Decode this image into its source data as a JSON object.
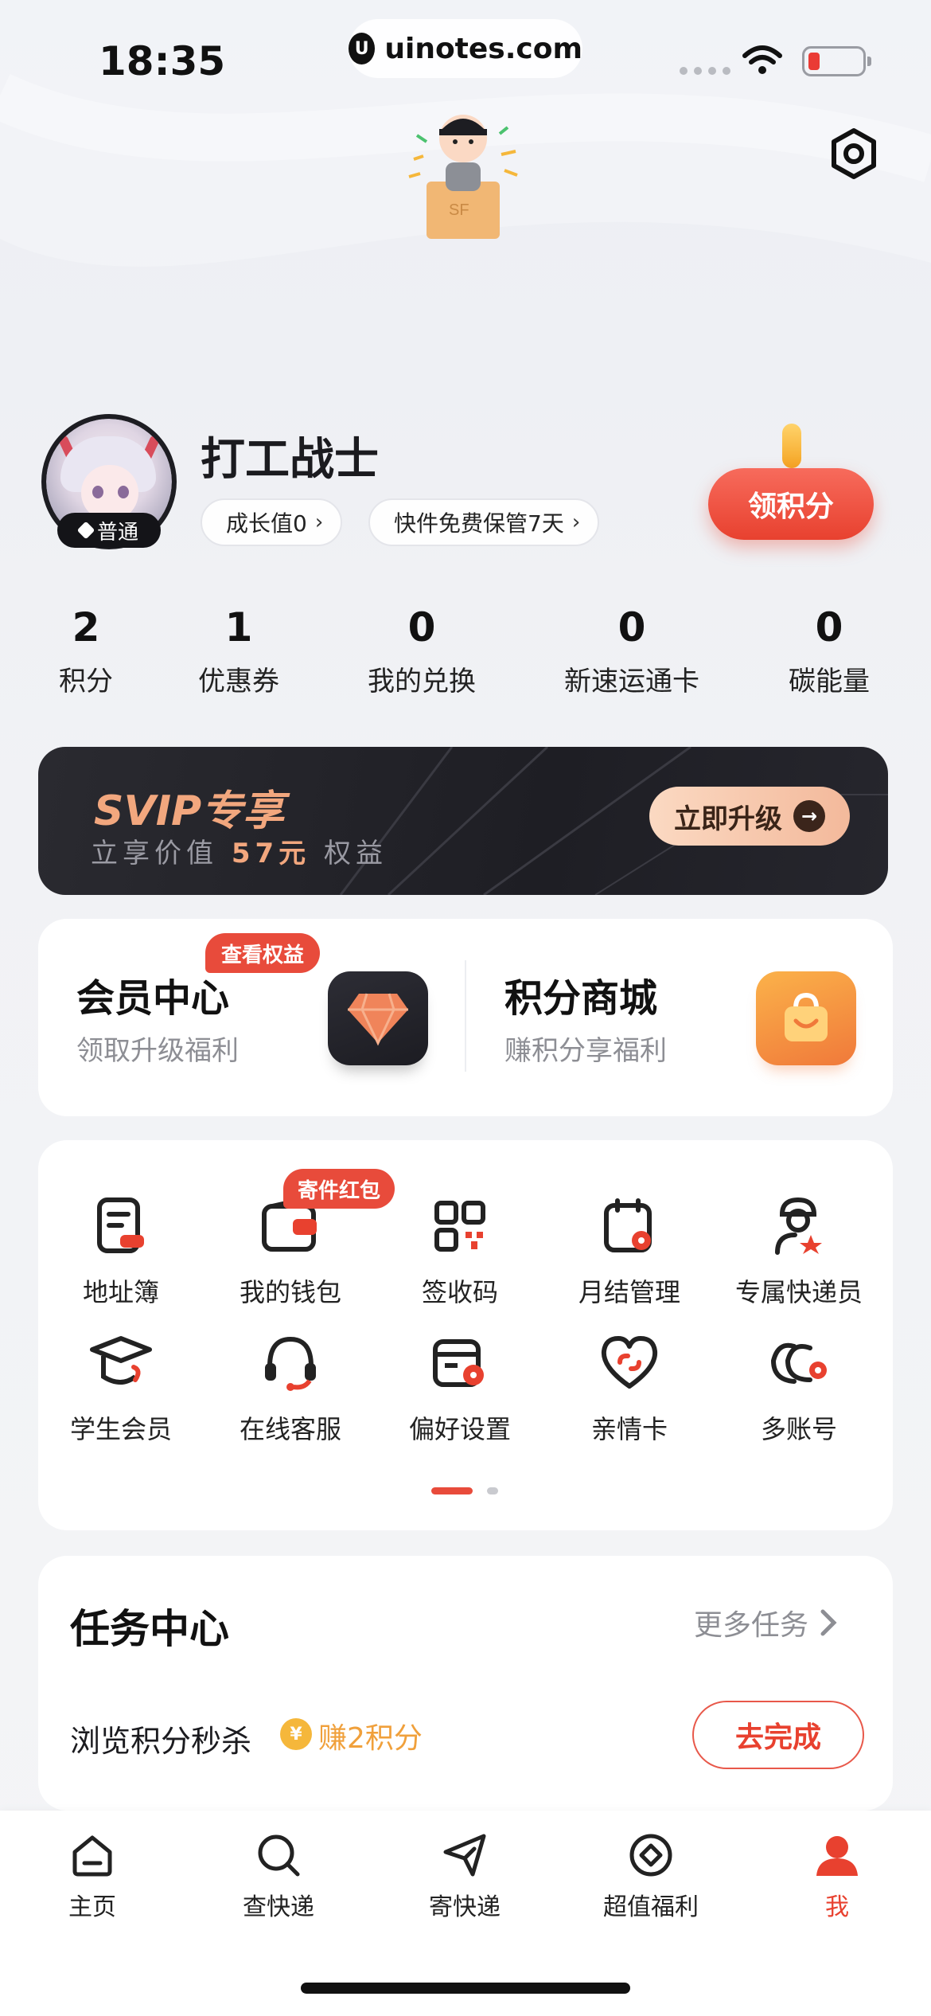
{
  "status_bar": {
    "time": "18:35",
    "url": "uinotes.com",
    "url_logo": "U"
  },
  "profile": {
    "username": "打工战士",
    "level": "普通",
    "growth_chip": "成长值0",
    "storage_chip": "快件免费保管7天",
    "claim_button": "领积分"
  },
  "stats": [
    {
      "value": "2",
      "label": "积分"
    },
    {
      "value": "1",
      "label": "优惠券"
    },
    {
      "value": "0",
      "label": "我的兑换"
    },
    {
      "value": "0",
      "label": "新速运通卡"
    },
    {
      "value": "0",
      "label": "碳能量"
    }
  ],
  "svip": {
    "title": "SVIP专享",
    "sub_prefix": "立享价值",
    "sub_amount": "57元",
    "sub_suffix": "权益",
    "upgrade_button": "立即升级"
  },
  "member_center": {
    "badge": "查看权益",
    "title": "会员中心",
    "subtitle": "领取升级福利"
  },
  "points_mall": {
    "title": "积分商城",
    "subtitle": "赚积分享福利"
  },
  "services": {
    "badge": "寄件红包",
    "items": [
      {
        "label": "地址簿",
        "icon": "address-book-icon"
      },
      {
        "label": "我的钱包",
        "icon": "wallet-icon"
      },
      {
        "label": "签收码",
        "icon": "qr-code-icon"
      },
      {
        "label": "月结管理",
        "icon": "calendar-settings-icon"
      },
      {
        "label": "专属快递员",
        "icon": "courier-icon"
      },
      {
        "label": "学生会员",
        "icon": "graduation-cap-icon"
      },
      {
        "label": "在线客服",
        "icon": "headset-icon"
      },
      {
        "label": "偏好设置",
        "icon": "preferences-icon"
      },
      {
        "label": "亲情卡",
        "icon": "heart-link-icon"
      },
      {
        "label": "多账号",
        "icon": "multi-account-icon"
      }
    ]
  },
  "tasks": {
    "title": "任务中心",
    "more": "更多任务",
    "task_name": "浏览积分秒杀",
    "coin_symbol": "¥",
    "reward": "赚2积分",
    "button": "去完成"
  },
  "tabbar": [
    {
      "label": "主页",
      "icon": "home-icon",
      "active": false
    },
    {
      "label": "查快递",
      "icon": "search-icon",
      "active": false
    },
    {
      "label": "寄快递",
      "icon": "send-icon",
      "active": false
    },
    {
      "label": "超值福利",
      "icon": "benefits-icon",
      "active": false
    },
    {
      "label": "我",
      "icon": "profile-icon",
      "active": true
    }
  ],
  "colors": {
    "accent": "#e8412f",
    "svip_gold": "#f2a77e",
    "reward_orange": "#f0a03b"
  }
}
